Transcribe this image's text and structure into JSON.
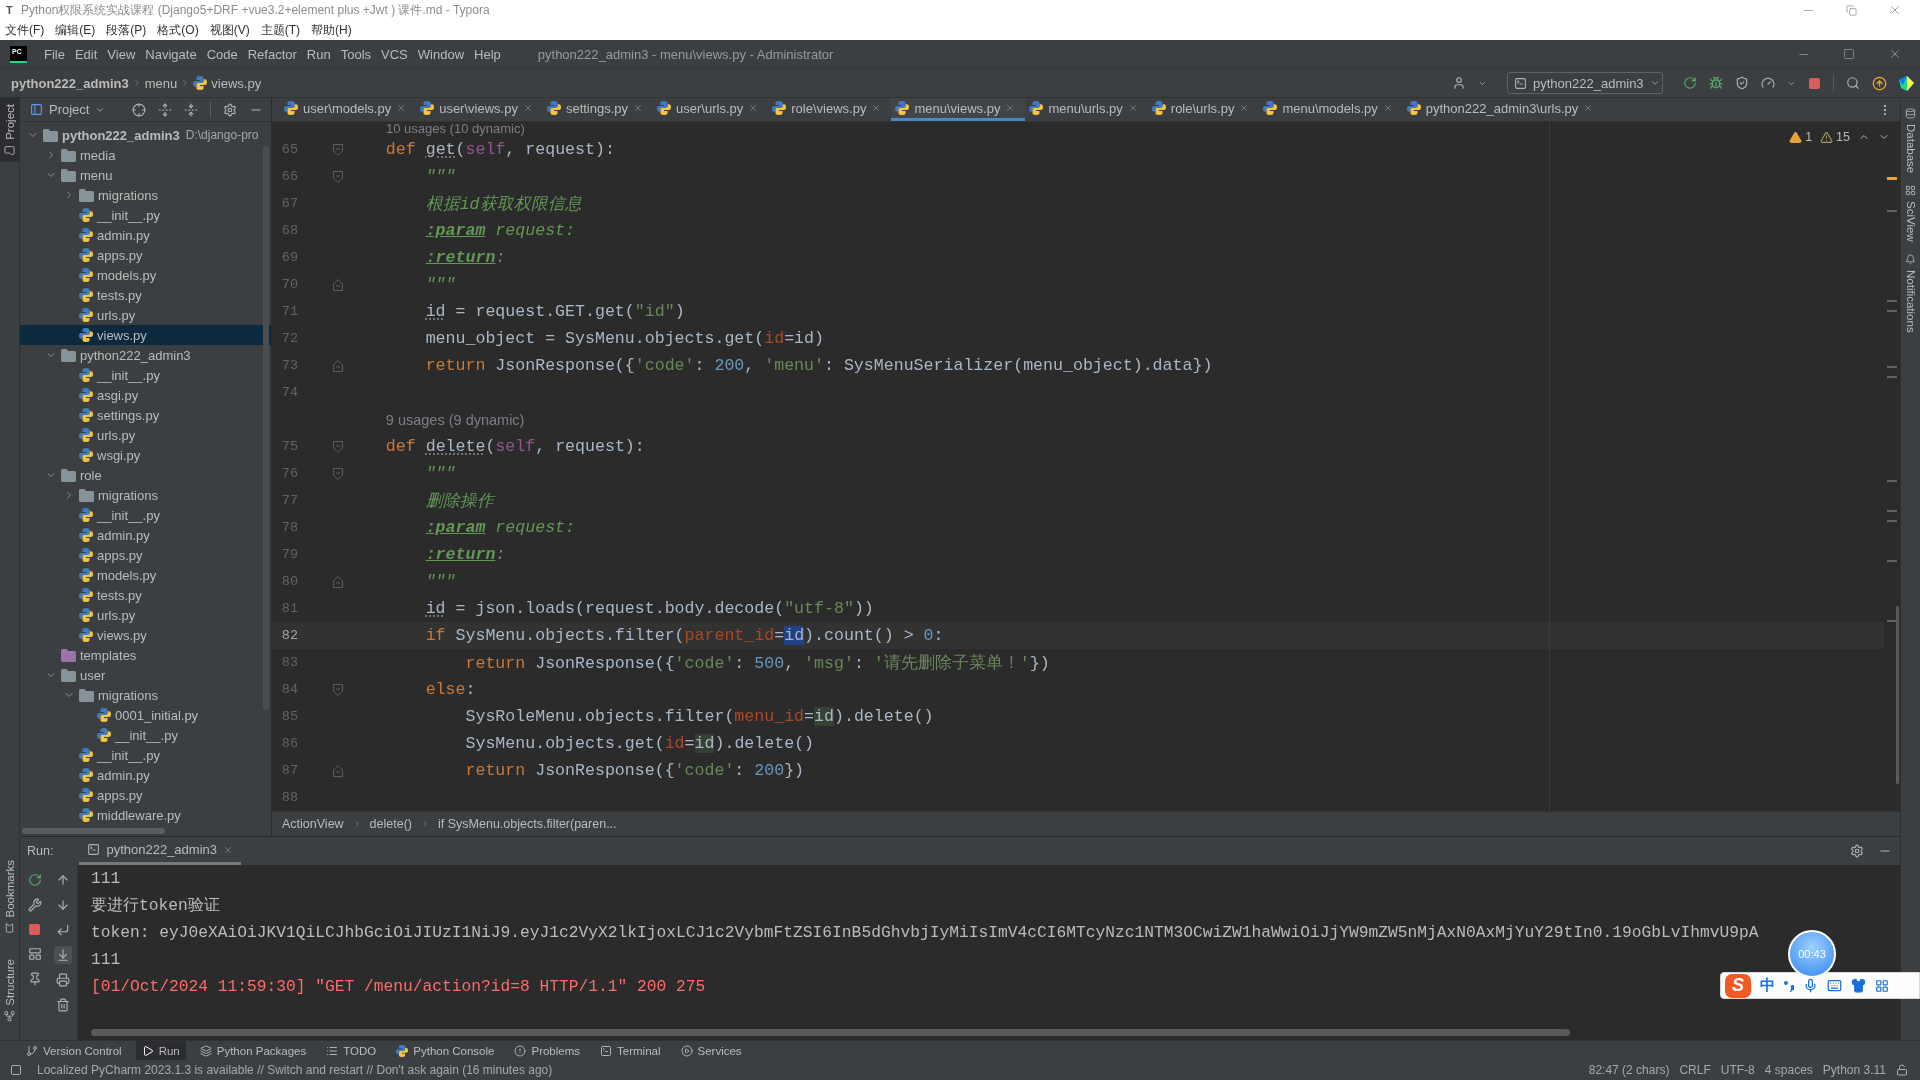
{
  "typora": {
    "logo": "T",
    "title": "Python权限系统实战课程 (Django5+DRF +vue3.2+element plus +Jwt ) 课件.md - Typora",
    "menu": [
      "文件(F)",
      "编辑(E)",
      "段落(P)",
      "格式(O)",
      "视图(V)",
      "主题(T)",
      "帮助(H)"
    ]
  },
  "ide": {
    "logo": "PC",
    "menu": [
      "File",
      "Edit",
      "View",
      "Navigate",
      "Code",
      "Refactor",
      "Run",
      "Tools",
      "VCS",
      "Window",
      "Help"
    ],
    "title": "python222_admin3 - menu\\views.py - Administrator"
  },
  "navbar": {
    "breadcrumbs": [
      {
        "label": "python222_admin3",
        "kind": "project"
      },
      {
        "label": "menu",
        "kind": "folder"
      },
      {
        "label": "views.py",
        "kind": "file"
      }
    ],
    "run_config": "python222_admin3"
  },
  "left_stripe": {
    "top": [
      {
        "label": "Project",
        "selected": true
      }
    ],
    "bottom": [
      {
        "label": "Bookmarks",
        "selected": false
      },
      {
        "label": "Structure",
        "selected": false
      }
    ]
  },
  "project": {
    "title": "Project",
    "tree": [
      {
        "label": "python222_admin3",
        "path": "D:\\django-pro",
        "kind": "folder",
        "expanded": true,
        "selected": false,
        "children": [
          {
            "label": "media",
            "kind": "folder",
            "expanded": false,
            "selected": false
          },
          {
            "label": "menu",
            "kind": "folder",
            "expanded": true,
            "selected": false,
            "children": [
              {
                "label": "migrations",
                "kind": "folder",
                "expanded": false,
                "selected": false
              },
              {
                "label": "__init__.py",
                "kind": "file",
                "selected": false
              },
              {
                "label": "admin.py",
                "kind": "file",
                "selected": false
              },
              {
                "label": "apps.py",
                "kind": "file",
                "selected": false
              },
              {
                "label": "models.py",
                "kind": "file",
                "selected": false
              },
              {
                "label": "tests.py",
                "kind": "file",
                "selected": false
              },
              {
                "label": "urls.py",
                "kind": "file",
                "selected": false
              },
              {
                "label": "views.py",
                "kind": "file",
                "selected": true
              }
            ]
          },
          {
            "label": "python222_admin3",
            "kind": "folder",
            "expanded": true,
            "selected": false,
            "children": [
              {
                "label": "__init__.py",
                "kind": "file",
                "selected": false
              },
              {
                "label": "asgi.py",
                "kind": "file",
                "selected": false
              },
              {
                "label": "settings.py",
                "kind": "file",
                "selected": false
              },
              {
                "label": "urls.py",
                "kind": "file",
                "selected": false
              },
              {
                "label": "wsgi.py",
                "kind": "file",
                "selected": false
              }
            ]
          },
          {
            "label": "role",
            "kind": "folder",
            "expanded": true,
            "selected": false,
            "children": [
              {
                "label": "migrations",
                "kind": "folder",
                "expanded": false,
                "selected": false
              },
              {
                "label": "__init__.py",
                "kind": "file",
                "selected": false
              },
              {
                "label": "admin.py",
                "kind": "file",
                "selected": false
              },
              {
                "label": "apps.py",
                "kind": "file",
                "selected": false
              },
              {
                "label": "models.py",
                "kind": "file",
                "selected": false
              },
              {
                "label": "tests.py",
                "kind": "file",
                "selected": false
              },
              {
                "label": "urls.py",
                "kind": "file",
                "selected": false
              },
              {
                "label": "views.py",
                "kind": "file",
                "selected": false
              }
            ]
          },
          {
            "label": "templates",
            "kind": "template-folder",
            "selected": false
          },
          {
            "label": "user",
            "kind": "folder",
            "expanded": true,
            "selected": false,
            "children": [
              {
                "label": "migrations",
                "kind": "folder",
                "expanded": true,
                "selected": false,
                "children": [
                  {
                    "label": "0001_initial.py",
                    "kind": "file",
                    "selected": false
                  },
                  {
                    "label": "__init__.py",
                    "kind": "file",
                    "selected": false
                  }
                ]
              },
              {
                "label": "__init__.py",
                "kind": "file",
                "selected": false
              },
              {
                "label": "admin.py",
                "kind": "file",
                "selected": false
              },
              {
                "label": "apps.py",
                "kind": "file",
                "selected": false
              },
              {
                "label": "middleware.py",
                "kind": "file",
                "selected": false
              }
            ]
          }
        ]
      }
    ]
  },
  "editor": {
    "tabs": [
      {
        "label": "user\\models.py",
        "selected": false
      },
      {
        "label": "user\\views.py",
        "selected": false
      },
      {
        "label": "settings.py",
        "selected": false
      },
      {
        "label": "user\\urls.py",
        "selected": false
      },
      {
        "label": "role\\views.py",
        "selected": false
      },
      {
        "label": "menu\\views.py",
        "selected": true
      },
      {
        "label": "menu\\urls.py",
        "selected": false
      },
      {
        "label": "role\\urls.py",
        "selected": false
      },
      {
        "label": "menu\\models.py",
        "selected": false
      },
      {
        "label": "python222_admin3\\urls.py",
        "selected": false
      }
    ],
    "warnings": [
      {
        "kind": "warning",
        "count": "1"
      },
      {
        "kind": "weak",
        "count": "15"
      }
    ],
    "top_hint": "10 usages (10 dynamic)",
    "lines": [
      {
        "kind": "code",
        "number": "65",
        "current": false,
        "fold_open": true,
        "tokens": [
          {
            "kind": "kw",
            "text": "def "
          },
          {
            "kind": "fn",
            "text": "get"
          },
          {
            "kind": "plain",
            "text": "("
          },
          {
            "kind": "self",
            "text": "self"
          },
          {
            "kind": "plain",
            "text": ", request):"
          }
        ],
        "children": [
          {
            "kind": "code",
            "number": "66",
            "current": false,
            "fold_open": true,
            "tokens": [
              {
                "kind": "doc",
                "text": "\"\"\""
              }
            ]
          },
          {
            "kind": "code",
            "number": "67",
            "current": false,
            "tokens": [
              {
                "kind": "doc",
                "text": "根据id获取权限信息"
              }
            ]
          },
          {
            "kind": "code",
            "number": "68",
            "current": false,
            "tokens": [
              {
                "kind": "doctag",
                "text": ":param"
              },
              {
                "kind": "doc",
                "text": " request:"
              }
            ]
          },
          {
            "kind": "code",
            "number": "69",
            "current": false,
            "tokens": [
              {
                "kind": "doctag",
                "text": ":return"
              },
              {
                "kind": "doc",
                "text": ":"
              }
            ]
          },
          {
            "kind": "code",
            "number": "70",
            "current": false,
            "fold_close": true,
            "tokens": [
              {
                "kind": "doc",
                "text": "\"\"\""
              }
            ]
          },
          {
            "kind": "code",
            "number": "71",
            "current": false,
            "tokens": [
              {
                "kind": "shadow",
                "text": "id"
              },
              {
                "kind": "plain",
                "text": " = request.GET.get("
              },
              {
                "kind": "str",
                "text": "\"id\""
              },
              {
                "kind": "plain",
                "text": ")"
              }
            ]
          },
          {
            "kind": "code",
            "number": "72",
            "current": false,
            "tokens": [
              {
                "kind": "plain",
                "text": "menu_object = SysMenu.objects.get("
              },
              {
                "kind": "arg",
                "text": "id"
              },
              {
                "kind": "plain",
                "text": "=id)"
              }
            ]
          },
          {
            "kind": "code",
            "number": "73",
            "current": false,
            "fold_close": true,
            "tokens": [
              {
                "kind": "kw",
                "text": "return"
              },
              {
                "kind": "plain",
                "text": " JsonResponse({"
              },
              {
                "kind": "str",
                "text": "'code'"
              },
              {
                "kind": "plain",
                "text": ": "
              },
              {
                "kind": "num",
                "text": "200"
              },
              {
                "kind": "plain",
                "text": ", "
              },
              {
                "kind": "str",
                "text": "'menu'"
              },
              {
                "kind": "plain",
                "text": ": SysMenuSerializer(menu_object).data})"
              }
            ]
          }
        ]
      },
      {
        "kind": "code",
        "number": "74",
        "current": false
      },
      {
        "kind": "hint",
        "text": "9 usages (9 dynamic)"
      },
      {
        "kind": "code",
        "number": "75",
        "current": false,
        "fold_open": true,
        "tokens": [
          {
            "kind": "kw",
            "text": "def "
          },
          {
            "kind": "fn",
            "text": "delete"
          },
          {
            "kind": "plain",
            "text": "("
          },
          {
            "kind": "self",
            "text": "self"
          },
          {
            "kind": "plain",
            "text": ", request):"
          }
        ],
        "children": [
          {
            "kind": "code",
            "number": "76",
            "current": false,
            "fold_open": true,
            "tokens": [
              {
                "kind": "doc",
                "text": "\"\"\""
              }
            ]
          },
          {
            "kind": "code",
            "number": "77",
            "current": false,
            "tokens": [
              {
                "kind": "doc",
                "text": "删除操作"
              }
            ]
          },
          {
            "kind": "code",
            "number": "78",
            "current": false,
            "tokens": [
              {
                "kind": "doctag",
                "text": ":param"
              },
              {
                "kind": "doc",
                "text": " request:"
              }
            ]
          },
          {
            "kind": "code",
            "number": "79",
            "current": false,
            "tokens": [
              {
                "kind": "doctag",
                "text": ":return"
              },
              {
                "kind": "doc",
                "text": ":"
              }
            ]
          },
          {
            "kind": "code",
            "number": "80",
            "current": false,
            "fold_close": true,
            "tokens": [
              {
                "kind": "doc",
                "text": "\"\"\""
              }
            ]
          },
          {
            "kind": "code",
            "number": "81",
            "current": false,
            "tokens": [
              {
                "kind": "shadow",
                "text": "id"
              },
              {
                "kind": "plain",
                "text": " = json.loads(request.body.decode("
              },
              {
                "kind": "str",
                "text": "\"utf-8\""
              },
              {
                "kind": "plain",
                "text": "))"
              }
            ]
          },
          {
            "kind": "code",
            "number": "82",
            "current": true,
            "tokens": [
              {
                "kind": "kw",
                "text": "if"
              },
              {
                "kind": "plain",
                "text": " SysMenu.objects.filter("
              },
              {
                "kind": "arg",
                "text": "parent_id"
              },
              {
                "kind": "plain",
                "text": "="
              },
              {
                "kind": "sel",
                "text": "id"
              },
              {
                "kind": "plain",
                "text": ").count() > "
              },
              {
                "kind": "num",
                "text": "0"
              },
              {
                "kind": "plain",
                "text": ":"
              }
            ],
            "children": [
              {
                "kind": "code",
                "number": "83",
                "current": false,
                "tokens": [
                  {
                    "kind": "kw",
                    "text": "return"
                  },
                  {
                    "kind": "plain",
                    "text": " JsonResponse({"
                  },
                  {
                    "kind": "str",
                    "text": "'code'"
                  },
                  {
                    "kind": "plain",
                    "text": ": "
                  },
                  {
                    "kind": "num",
                    "text": "500"
                  },
                  {
                    "kind": "plain",
                    "text": ", "
                  },
                  {
                    "kind": "str",
                    "text": "'msg'"
                  },
                  {
                    "kind": "plain",
                    "text": ": "
                  },
                  {
                    "kind": "str",
                    "text": "'请先删除子菜单！'"
                  },
                  {
                    "kind": "plain",
                    "text": "})"
                  }
                ]
              }
            ]
          },
          {
            "kind": "code",
            "number": "84",
            "current": false,
            "fold_open": true,
            "tokens": [
              {
                "kind": "kw",
                "text": "else"
              },
              {
                "kind": "plain",
                "text": ":"
              }
            ],
            "children": [
              {
                "kind": "code",
                "number": "85",
                "current": false,
                "tokens": [
                  {
                    "kind": "plain",
                    "text": "SysRoleMenu.objects.filter("
                  },
                  {
                    "kind": "arg",
                    "text": "menu_id"
                  },
                  {
                    "kind": "plain",
                    "text": "="
                  },
                  {
                    "kind": "occ",
                    "text": "id"
                  },
                  {
                    "kind": "plain",
                    "text": ").delete()"
                  }
                ]
              },
              {
                "kind": "code",
                "number": "86",
                "current": false,
                "tokens": [
                  {
                    "kind": "plain",
                    "text": "SysMenu.objects.get("
                  },
                  {
                    "kind": "arg",
                    "text": "id"
                  },
                  {
                    "kind": "plain",
                    "text": "="
                  },
                  {
                    "kind": "occ",
                    "text": "id"
                  },
                  {
                    "kind": "plain",
                    "text": ").delete()"
                  }
                ]
              },
              {
                "kind": "code",
                "number": "87",
                "current": false,
                "fold_close": true,
                "tokens": [
                  {
                    "kind": "kw",
                    "text": "return"
                  },
                  {
                    "kind": "plain",
                    "text": " JsonResponse({"
                  },
                  {
                    "kind": "str",
                    "text": "'code'"
                  },
                  {
                    "kind": "plain",
                    "text": ": "
                  },
                  {
                    "kind": "num",
                    "text": "200"
                  },
                  {
                    "kind": "plain",
                    "text": "})"
                  }
                ]
              }
            ]
          }
        ]
      },
      {
        "kind": "code",
        "number": "88",
        "current": false
      }
    ],
    "breadcrumbs": [
      "ActionView",
      "delete()",
      "if SysMenu.objects.filter(paren..."
    ]
  },
  "right_stripe": [
    {
      "label": "Database",
      "selected": false
    },
    {
      "label": "SciView",
      "selected": false
    },
    {
      "label": "Notifications",
      "selected": false
    }
  ],
  "run": {
    "label": "Run:",
    "tabs": [
      {
        "label": "python222_admin3",
        "selected": true
      }
    ],
    "scroll_to_end": true,
    "output": [
      {
        "kind": "out",
        "text": "111"
      },
      {
        "kind": "out",
        "text": "要进行token验证"
      },
      {
        "kind": "out",
        "text": "token: eyJ0eXAiOiJKV1QiLCJhbGciOiJIUzI1NiJ9.eyJ1c2VyX2lkIjoxLCJ1c2VybmFtZSI6InB5dGhvbjIyMiIsImV4cCI6MTcyNzc1NTM3OCwiZW1haWwiOiJjYW9mZW5nMjAxN0AxMjYuY29tIn0.19oGbLvIhmvU9pA"
      },
      {
        "kind": "out",
        "text": "111"
      },
      {
        "kind": "err",
        "text": "[01/Oct/2024 11:59:30] \"GET /menu/action?id=8 HTTP/1.1\" 200 275"
      }
    ]
  },
  "tool_tabs": [
    {
      "label": "Version Control",
      "selected": false
    },
    {
      "label": "Run",
      "selected": true
    },
    {
      "label": "Python Packages",
      "selected": false
    },
    {
      "label": "TODO",
      "selected": false
    },
    {
      "label": "Python Console",
      "selected": false
    },
    {
      "label": "Problems",
      "selected": false
    },
    {
      "label": "Terminal",
      "selected": false
    },
    {
      "label": "Services",
      "selected": false
    }
  ],
  "status": {
    "message": "Localized PyCharm 2023.1.3 is available // Switch and restart // Don't ask again (16 minutes ago)",
    "items": [
      "82:47 (2 chars)",
      "CRLF",
      "UTF-8",
      "4 spaces",
      "Python 3.11"
    ]
  },
  "overlays": {
    "timer": "00:43",
    "ime": {
      "logo": "S",
      "mode": "中"
    }
  }
}
